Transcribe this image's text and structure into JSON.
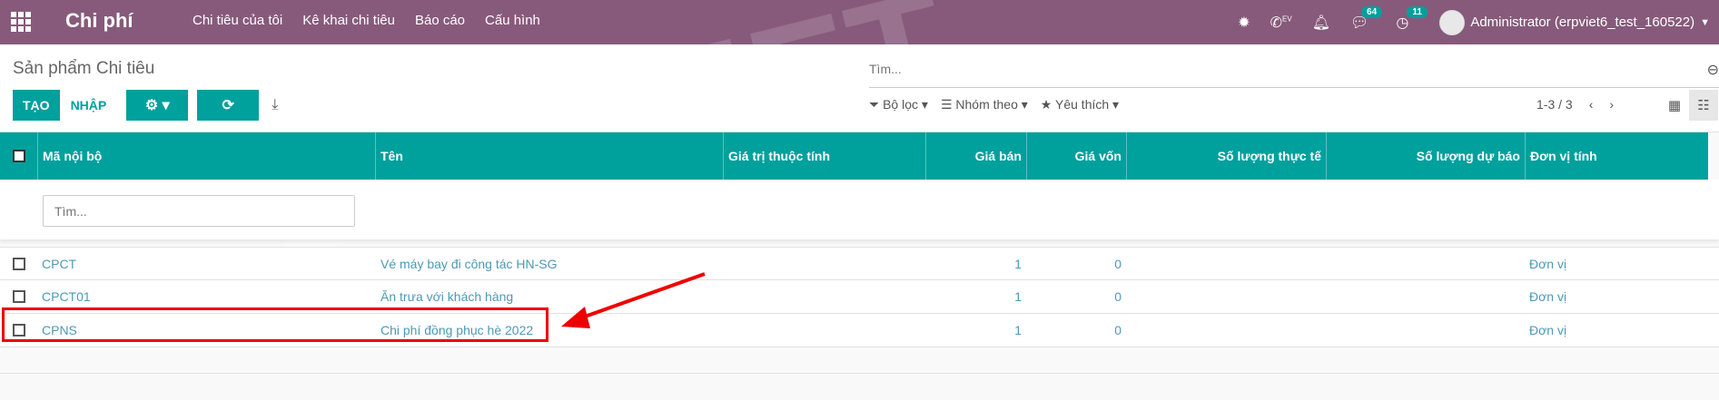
{
  "topbar": {
    "app_title": "Chi phí",
    "menu": [
      "Chi tiêu của tôi",
      "Kê khai chi tiêu",
      "Báo cáo",
      "Cấu hình"
    ],
    "messages_badge": "64",
    "activities_badge": "11",
    "user_name": "Administrator (erpviet6_test_160522)",
    "phone_label": "EV"
  },
  "control": {
    "page_title": "Sản phẩm Chi tiêu",
    "search_placeholder": "Tìm...",
    "create_label": "TẠO",
    "import_label": "NHẬP",
    "filter_label": "Bộ lọc",
    "groupby_label": "Nhóm theo",
    "favorites_label": "Yêu thích",
    "pager": "1-3 / 3"
  },
  "table": {
    "headers": [
      "Mã nội bộ",
      "Tên",
      "Giá trị thuộc tính",
      "Giá bán",
      "Giá vốn",
      "Số lượng thực tế",
      "Số lượng dự báo",
      "Đơn vị tính"
    ],
    "filter_placeholder": "Tìm...",
    "rows": [
      {
        "code": "CPCT",
        "name": "Vé máy bay đi công tác HN-SG",
        "price": "1",
        "cost": "0",
        "uom": "Đơn vị"
      },
      {
        "code": "CPCT01",
        "name": "Ăn trưa với khách hàng",
        "price": "1",
        "cost": "0",
        "uom": "Đơn vị"
      },
      {
        "code": "CPNS",
        "name": "Chi phí đồng phục hè 2022",
        "price": "1",
        "cost": "0",
        "uom": "Đơn vị"
      }
    ]
  },
  "colors": {
    "topbar": "#875a7b",
    "accent": "#00a09d",
    "highlight": "#ee0000"
  }
}
